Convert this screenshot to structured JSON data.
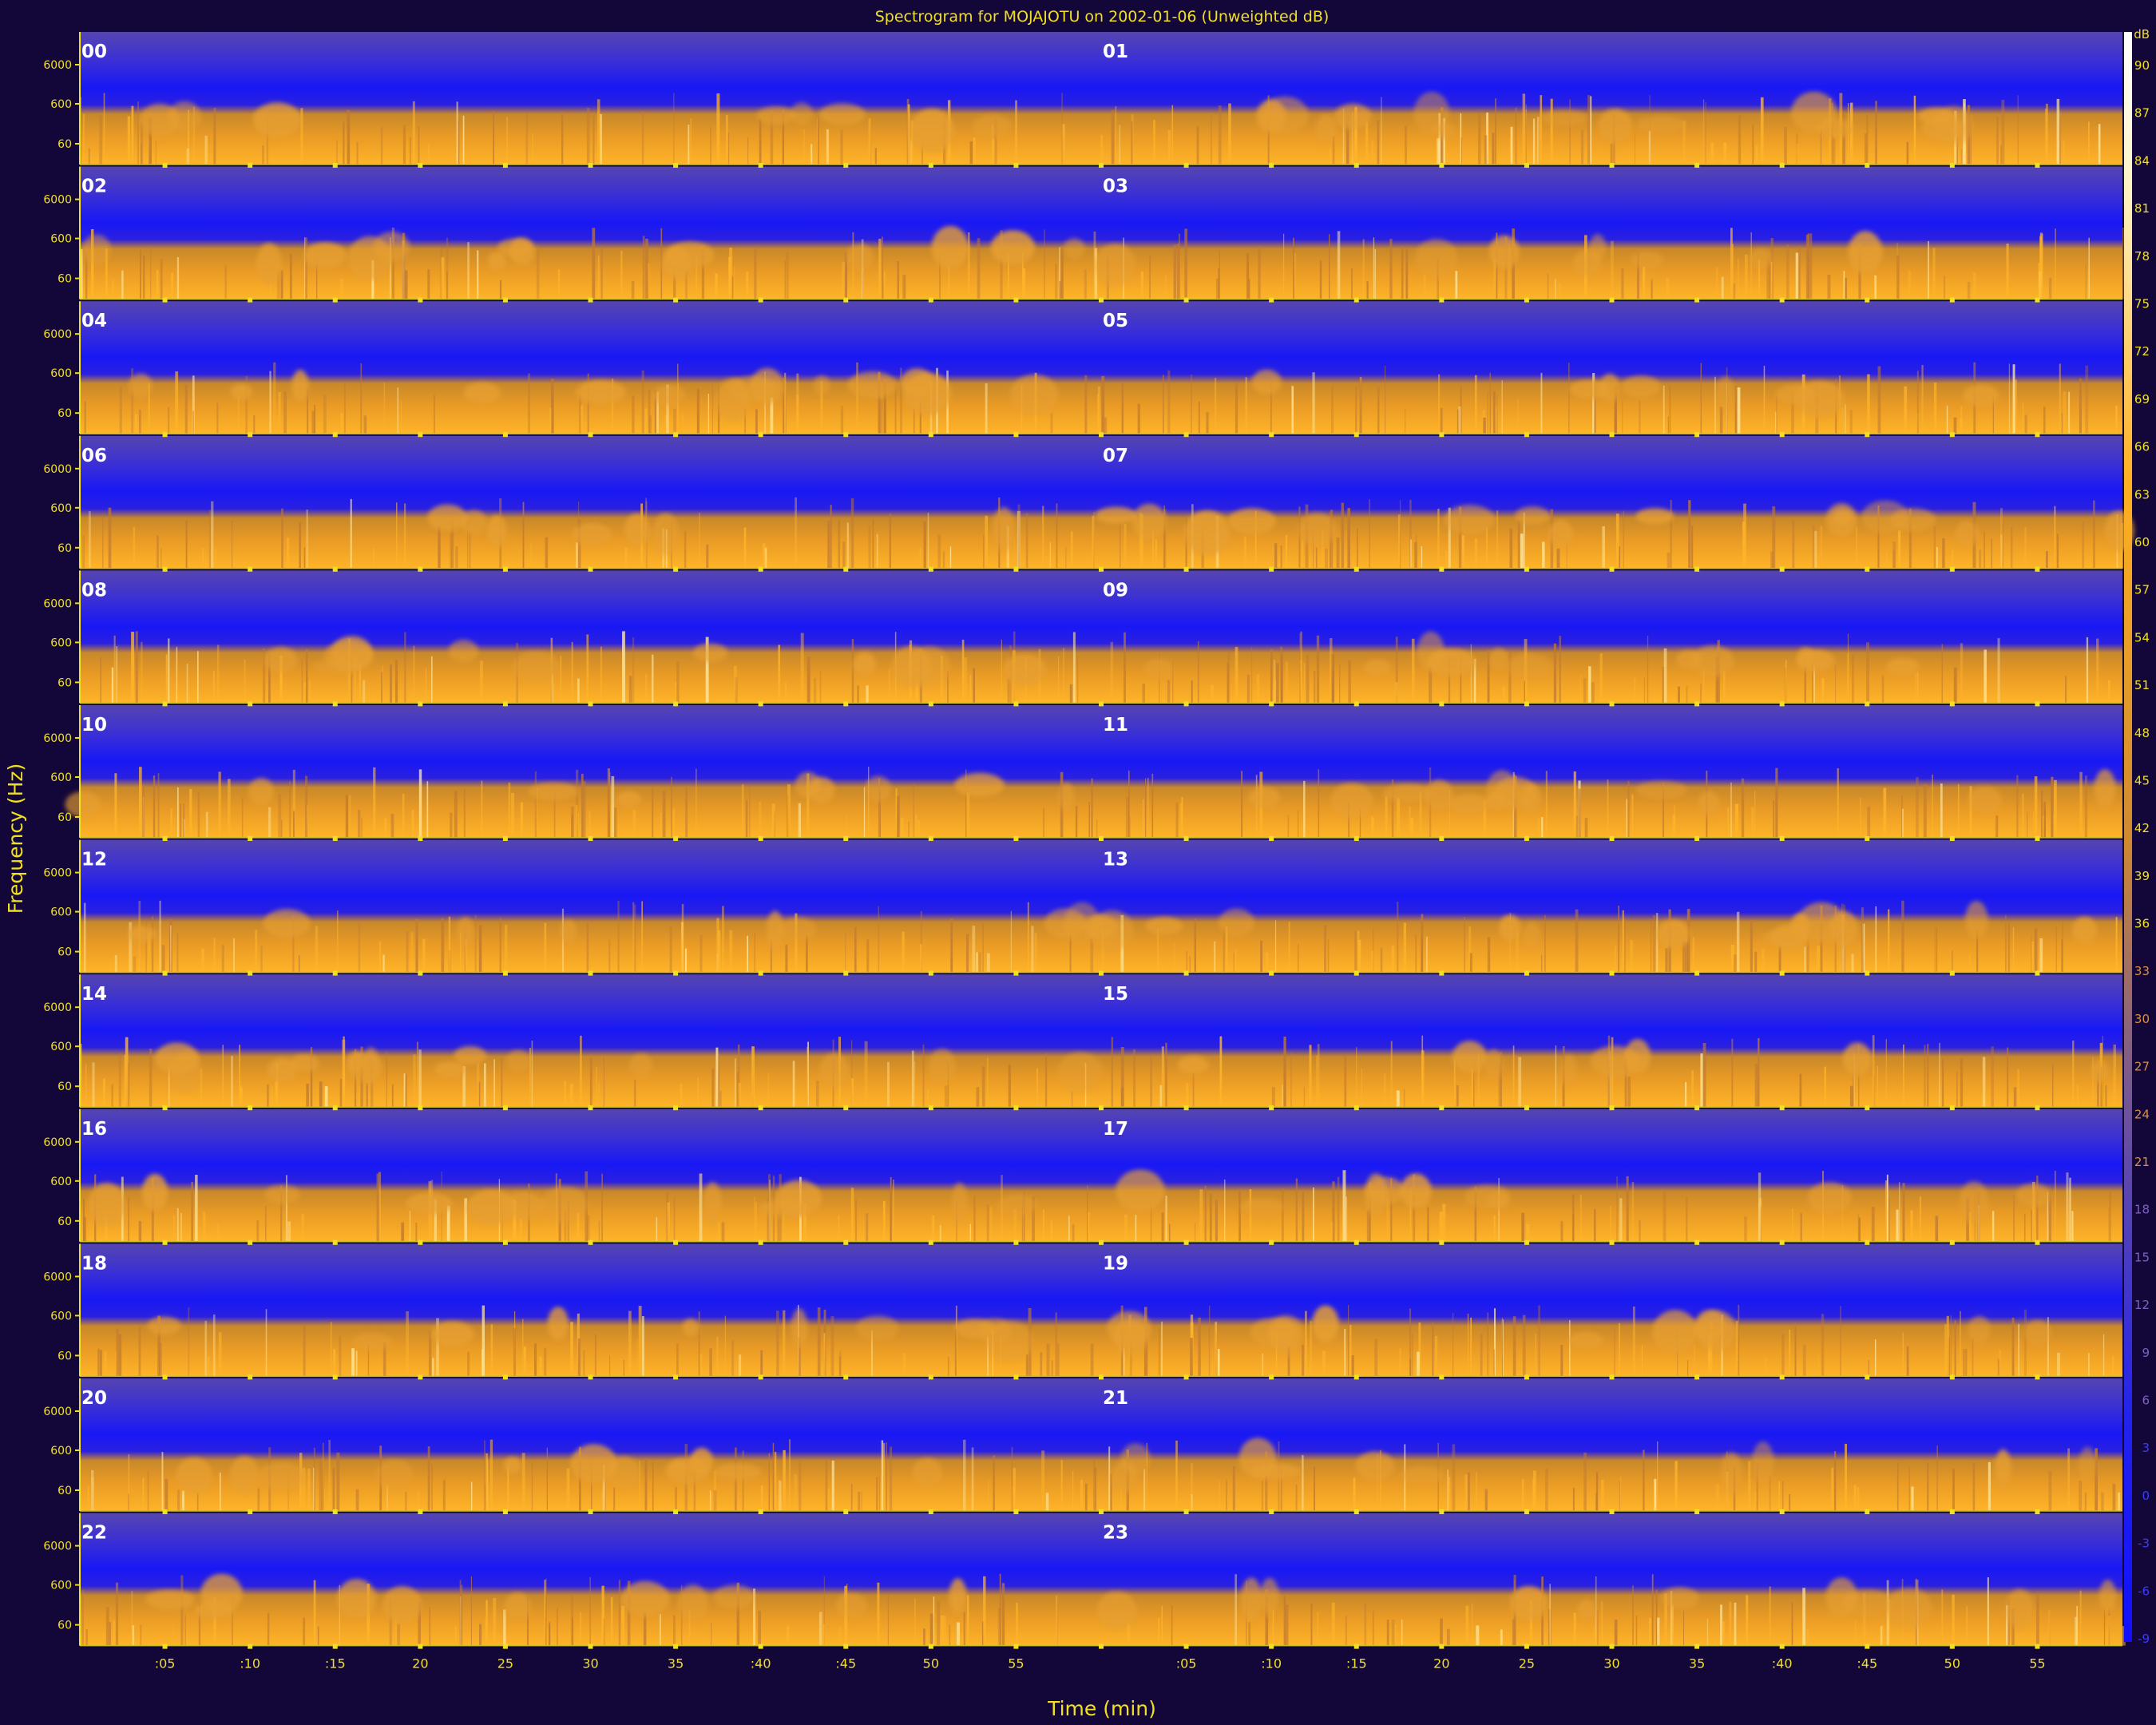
{
  "chart_data": {
    "type": "heatmap",
    "title": "Spectrogram for MOJAJOTU on 2002-01-06 (Unweighted dB)",
    "xlabel": "Time (min)",
    "ylabel": "Frequency (Hz)",
    "yticks": [
      "6000",
      "600",
      "60"
    ],
    "xticks": [
      ":05",
      ":10",
      ":15",
      "20",
      "25",
      "30",
      "35",
      ":40",
      ":45",
      "50",
      "55",
      "",
      ":05",
      ":10",
      ":15",
      "20",
      "25",
      "30",
      "35",
      ":40",
      ":45",
      "50",
      "55"
    ],
    "hours": [
      "00",
      "01",
      "02",
      "03",
      "04",
      "05",
      "06",
      "07",
      "08",
      "09",
      "10",
      "11",
      "12",
      "13",
      "14",
      "15",
      "16",
      "17",
      "18",
      "19",
      "20",
      "21",
      "22",
      "23"
    ],
    "colorbar": {
      "unit": "dB",
      "ticks": [
        "90",
        "87",
        "84",
        "81",
        "78",
        "75",
        "72",
        "69",
        "66",
        "63",
        "60",
        "57",
        "54",
        "51",
        "48",
        "45",
        "42",
        "39",
        "36",
        "33",
        "30",
        "27",
        "24",
        "21",
        "18",
        "15",
        "12",
        "9",
        "6",
        "3",
        "0",
        "-3",
        "-6",
        "-9"
      ]
    },
    "colors": {
      "background": "#13073a",
      "low": "#1a1aff",
      "mid": "#4a35a6",
      "high": "#ffa820",
      "peak": "#fff2c0",
      "axis": "#f0e020"
    }
  }
}
